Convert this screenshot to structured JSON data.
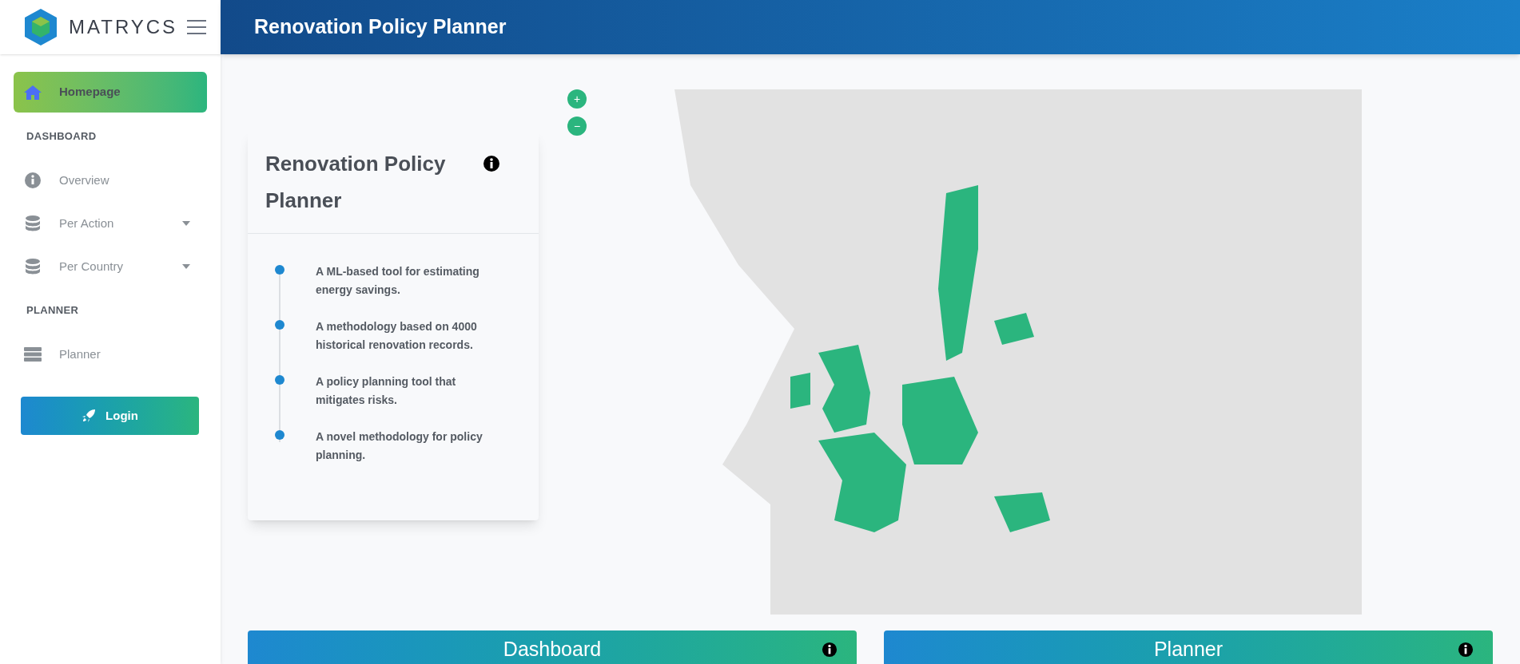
{
  "header": {
    "brand": "MATRYCS",
    "title": "Renovation Policy Planner"
  },
  "sidebar": {
    "items": [
      {
        "kind": "link",
        "label": "Homepage",
        "selected": true,
        "dropdown": false
      },
      {
        "kind": "section",
        "label": "DASHBOARD"
      },
      {
        "kind": "link",
        "label": "Overview",
        "selected": false,
        "dropdown": false
      },
      {
        "kind": "link",
        "label": "Per Action",
        "selected": false,
        "dropdown": true
      },
      {
        "kind": "link",
        "label": "Per Country",
        "selected": false,
        "dropdown": true
      },
      {
        "kind": "section",
        "label": "PLANNER"
      },
      {
        "kind": "link",
        "label": "Planner",
        "selected": false,
        "dropdown": false
      }
    ],
    "login": "Login"
  },
  "info_card": {
    "title": "Renovation Policy Planner",
    "timeline": [
      "A ML-based tool for estimating energy savings.",
      "A methodology based on 4000 historical renovation records.",
      "A policy planning tool that mitigates risks.",
      "A novel methodology for policy planning."
    ]
  },
  "map": {
    "zoom_in": "+",
    "zoom_out": "−"
  },
  "bottom_cards": [
    {
      "title": "Dashboard"
    },
    {
      "title": "Planner"
    }
  ]
}
